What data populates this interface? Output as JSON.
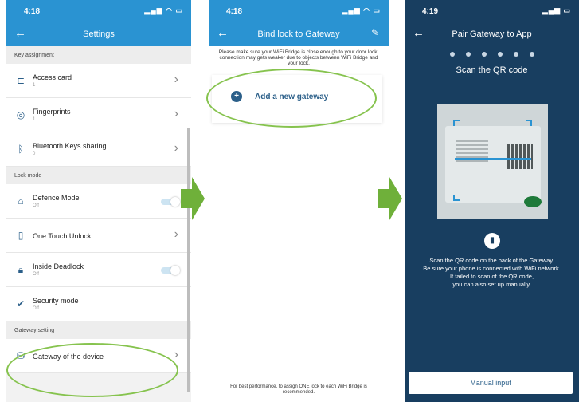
{
  "screen1": {
    "status_time": "4:18",
    "header_title": "Settings",
    "sections": {
      "key_assignment": "Key assignment",
      "lock_mode": "Lock mode",
      "gateway_setting": "Gateway setting"
    },
    "items": {
      "access_card": {
        "label": "Access card",
        "sub": "1"
      },
      "fingerprints": {
        "label": "Fingerprints",
        "sub": "1"
      },
      "bluetooth_keys": {
        "label": "Bluetooth Keys sharing",
        "sub": "0"
      },
      "defence_mode": {
        "label": "Defence Mode",
        "sub": "Off"
      },
      "one_touch": {
        "label": "One Touch Unlock"
      },
      "inside_deadlock": {
        "label": "Inside Deadlock",
        "sub": "Off"
      },
      "security_mode": {
        "label": "Security mode",
        "sub": "Off"
      },
      "gateway_device": {
        "label": "Gateway of the device"
      }
    }
  },
  "screen2": {
    "status_time": "4:18",
    "header_title": "Bind lock to Gateway",
    "notice": "Please make sure your WiFi Bridge is close enough to your door lock, connection may gets weaker due to objects between WiFi Bridge and your lock.",
    "add_gateway": "Add a new gateway",
    "footnote": "For best performance, to assign ONE lock to each WiFi Bridge is recommended."
  },
  "screen3": {
    "status_time": "4:19",
    "header_title": "Pair Gateway to App",
    "scan_title": "Scan the QR code",
    "hint_lines": [
      "Scan the QR code on the back of the Gateway.",
      "Be sure your phone is connected with WiFi network.",
      "If failed to scan of the QR code,",
      "you can also set up manually."
    ],
    "manual_button": "Manual input"
  },
  "colors": {
    "header_blue": "#2a93d2",
    "dark_navy": "#183e60",
    "icon_blue": "#2b5f89",
    "highlight_green": "#86c34e",
    "arrow_green": "#6fb03a"
  }
}
